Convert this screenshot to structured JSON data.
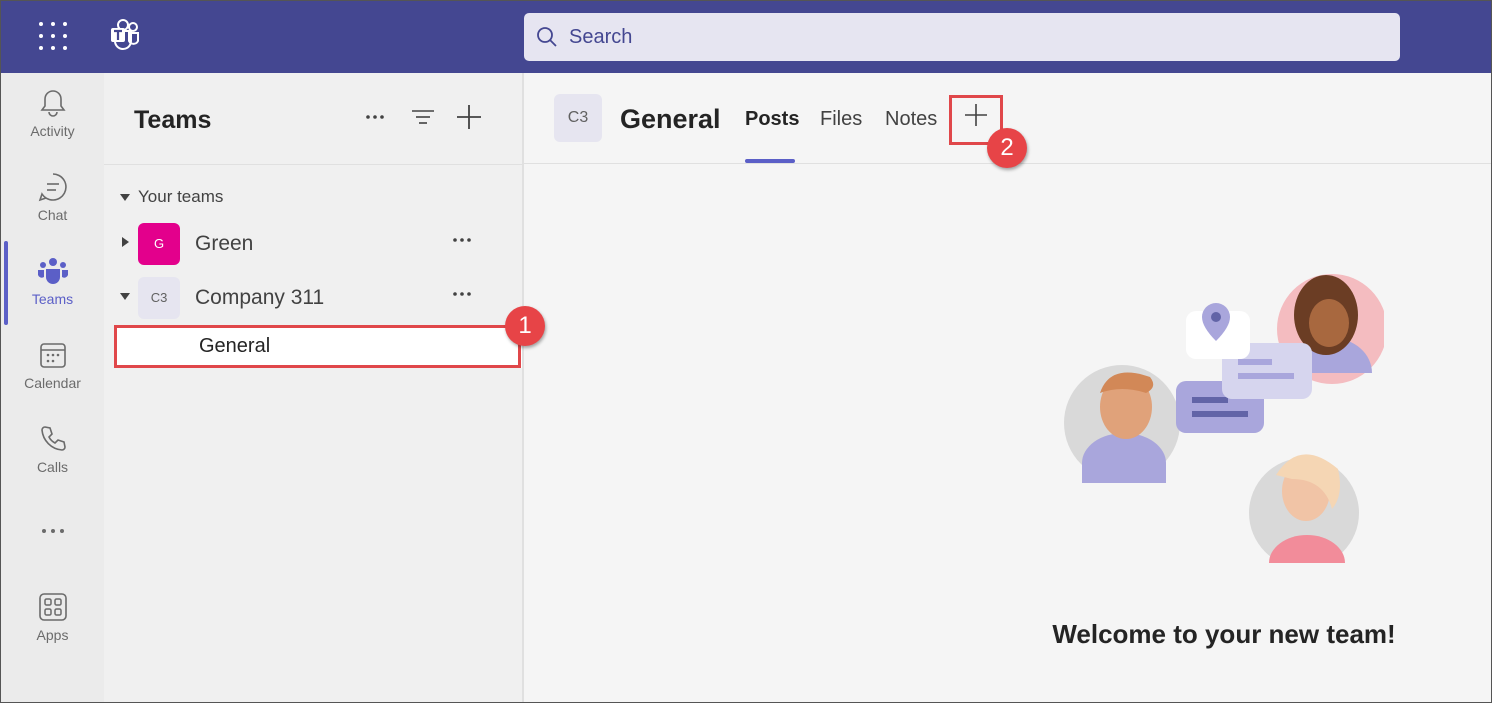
{
  "topbar": {
    "search_placeholder": "Search",
    "color": "#444791"
  },
  "rail": {
    "items": [
      {
        "label": "Activity",
        "icon": "bell-icon"
      },
      {
        "label": "Chat",
        "icon": "chat-icon"
      },
      {
        "label": "Teams",
        "icon": "teams-icon",
        "active": true
      },
      {
        "label": "Calendar",
        "icon": "calendar-icon"
      },
      {
        "label": "Calls",
        "icon": "phone-icon"
      },
      {
        "label": "",
        "icon": "more-icon"
      },
      {
        "label": "Apps",
        "icon": "apps-icon"
      }
    ]
  },
  "panel": {
    "title": "Teams",
    "section_label": "Your teams",
    "teams": [
      {
        "initials": "G",
        "name": "Green",
        "avatar_color": "#e3008c",
        "expanded": false
      },
      {
        "initials": "C3",
        "name": "Company 311",
        "avatar_color": "#e6e5f0",
        "expanded": true
      }
    ],
    "channels": [
      {
        "name": "General"
      }
    ]
  },
  "main": {
    "channel_initials": "C3",
    "channel_title": "General",
    "tabs": [
      {
        "label": "Posts",
        "active": true
      },
      {
        "label": "Files"
      },
      {
        "label": "Notes"
      }
    ],
    "welcome_title": "Welcome to your new team!"
  },
  "annotations": [
    {
      "number": "1"
    },
    {
      "number": "2"
    }
  ],
  "colors": {
    "accent": "#5b5fc7",
    "callout": "#e74447"
  }
}
